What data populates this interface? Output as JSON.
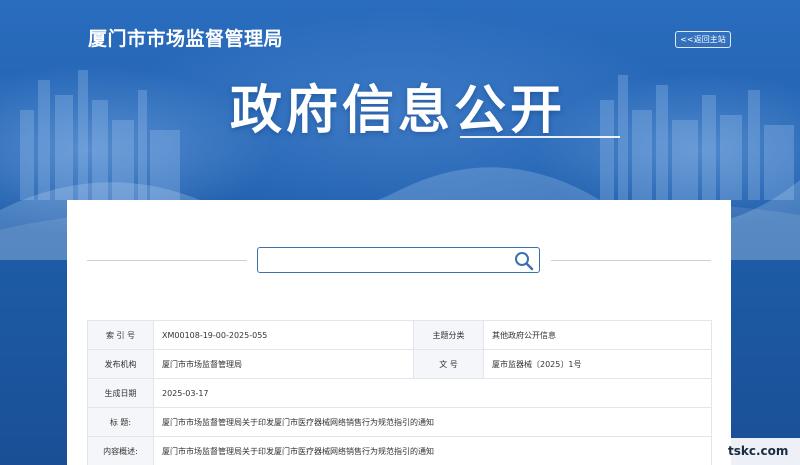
{
  "header": {
    "site_title": "厦门市市场监督管理局",
    "back_home_label": "<<返回主站",
    "hero_title": "政府信息公开"
  },
  "search": {
    "placeholder": "",
    "value": ""
  },
  "info_table": {
    "index_label": "索 引 号",
    "index_value": "XM00108-19-00-2025-055",
    "topic_label": "主题分类",
    "topic_value": "其他政府公开信息",
    "publisher_label": "发布机构",
    "publisher_value": "厦门市市场监督管理局",
    "doc_no_label": "文 号",
    "doc_no_value": "厦市监器械〔2025〕1号",
    "date_label": "生成日期",
    "date_value": "2025-03-17",
    "title_label": "标 题:",
    "title_value": "厦门市市场监督管理局关于印发厦门市医疗器械网络销售行为规范指引的通知",
    "summary_label": "内容概述:",
    "summary_value": "厦门市市场监督管理局关于印发厦门市医疗器械网络销售行为规范指引的通知"
  },
  "watermark_text": "tskc.com",
  "colors": {
    "banner": "#1e5fae",
    "search_border": "#3a6fb0",
    "label_bg": "#f4f6f9"
  },
  "icons": [
    "search-icon"
  ]
}
